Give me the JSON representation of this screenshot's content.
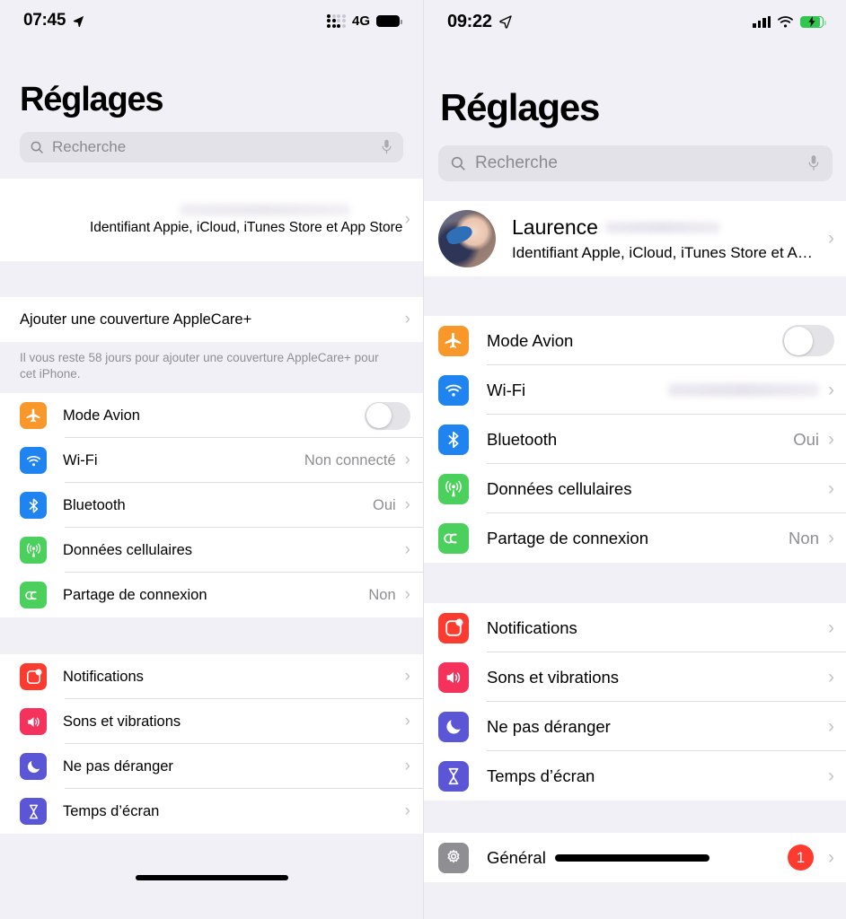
{
  "meta": {
    "app_title": "Réglages",
    "language": "fr"
  },
  "left_phone": {
    "status_bar": {
      "time": "07:45",
      "location_icon": "location-arrow-icon",
      "signal_icon": "cellular-signal-dots-icon",
      "network": "4G",
      "battery_icon": "battery-full-icon"
    },
    "title": "Réglages",
    "search": {
      "placeholder": "Recherche",
      "value": "",
      "icon": "search-icon",
      "mic_icon": "microphone-icon"
    },
    "account": {
      "name_redacted": true,
      "subtitle": "Identifiant Appie, iCloud, iTunes Store et App Store",
      "avatar": "user-avatar-blurred"
    },
    "applecare": {
      "label": "Ajouter une couverture AppleCare+",
      "note": "Il vous reste 58 jours pour ajouter une couverture AppleCare+ pour cet iPhone."
    },
    "connectivity": [
      {
        "label": "Mode Avion",
        "icon": "airplane-icon",
        "color": "#f8982a",
        "control": "toggle",
        "toggle_on": false,
        "value": ""
      },
      {
        "label": "Wi-Fi",
        "icon": "wifi-icon",
        "color": "#1f84ef",
        "control": "chevron",
        "value": "Non connecté"
      },
      {
        "label": "Bluetooth",
        "icon": "bluetooth-icon",
        "color": "#1f84ef",
        "control": "chevron",
        "value": "Oui"
      },
      {
        "label": "Données cellulaires",
        "icon": "cellular-antenna-icon",
        "color": "#4cd05d",
        "control": "chevron",
        "value": ""
      },
      {
        "label": "Partage de connexion",
        "icon": "personal-hotspot-icon",
        "color": "#4cd05d",
        "control": "chevron",
        "value": "Non"
      }
    ],
    "notifications_group": [
      {
        "label": "Notifications",
        "icon": "notifications-icon",
        "color": "#fb3b30",
        "control": "chevron",
        "value": ""
      },
      {
        "label": "Sons et vibrations",
        "icon": "sound-icon",
        "color": "#f4325c",
        "control": "chevron",
        "value": ""
      },
      {
        "label": "Ne pas déranger",
        "icon": "moon-icon",
        "color": "#5a56d6",
        "control": "chevron",
        "value": ""
      },
      {
        "label": "Temps d’écran",
        "icon": "hourglass-icon",
        "color": "#5a56d6",
        "control": "chevron",
        "value": ""
      }
    ]
  },
  "right_phone": {
    "status_bar": {
      "time": "09:22",
      "location_icon": "location-arrow-icon",
      "signal_icon": "cellular-signal-bars-icon",
      "wifi_icon": "wifi-icon",
      "battery_icon": "battery-charging-icon",
      "battery_color": "#30c74e"
    },
    "title": "Réglages",
    "search": {
      "placeholder": "Recherche",
      "value": "",
      "icon": "search-icon",
      "mic_icon": "microphone-icon"
    },
    "account": {
      "name": "Laurence",
      "name_suffix_redacted": true,
      "subtitle": "Identifiant Apple, iCloud, iTunes Store et A…",
      "avatar": "user-avatar-photo"
    },
    "connectivity": [
      {
        "label": "Mode Avion",
        "icon": "airplane-icon",
        "color": "#f8982a",
        "control": "toggle",
        "toggle_on": false,
        "value": ""
      },
      {
        "label": "Wi-Fi",
        "icon": "wifi-icon",
        "color": "#1f84ef",
        "control": "chevron",
        "value": "",
        "value_redacted": true
      },
      {
        "label": "Bluetooth",
        "icon": "bluetooth-icon",
        "color": "#1f84ef",
        "control": "chevron",
        "value": "Oui"
      },
      {
        "label": "Données cellulaires",
        "icon": "cellular-antenna-icon",
        "color": "#4cd05d",
        "control": "chevron",
        "value": ""
      },
      {
        "label": "Partage de connexion",
        "icon": "personal-hotspot-icon",
        "color": "#4cd05d",
        "control": "chevron",
        "value": "Non"
      }
    ],
    "notifications_group": [
      {
        "label": "Notifications",
        "icon": "notifications-icon",
        "color": "#fb3b30",
        "control": "chevron",
        "value": ""
      },
      {
        "label": "Sons et vibrations",
        "icon": "sound-icon",
        "color": "#f4325c",
        "control": "chevron",
        "value": ""
      },
      {
        "label": "Ne pas déranger",
        "icon": "moon-icon",
        "color": "#5a56d6",
        "control": "chevron",
        "value": ""
      },
      {
        "label": "Temps d’écran",
        "icon": "hourglass-icon",
        "color": "#5a56d6",
        "control": "chevron",
        "value": ""
      }
    ],
    "general_group": [
      {
        "label": "Général",
        "icon": "gear-icon",
        "color": "#8e8e93",
        "control": "chevron",
        "badge": "1"
      }
    ]
  }
}
